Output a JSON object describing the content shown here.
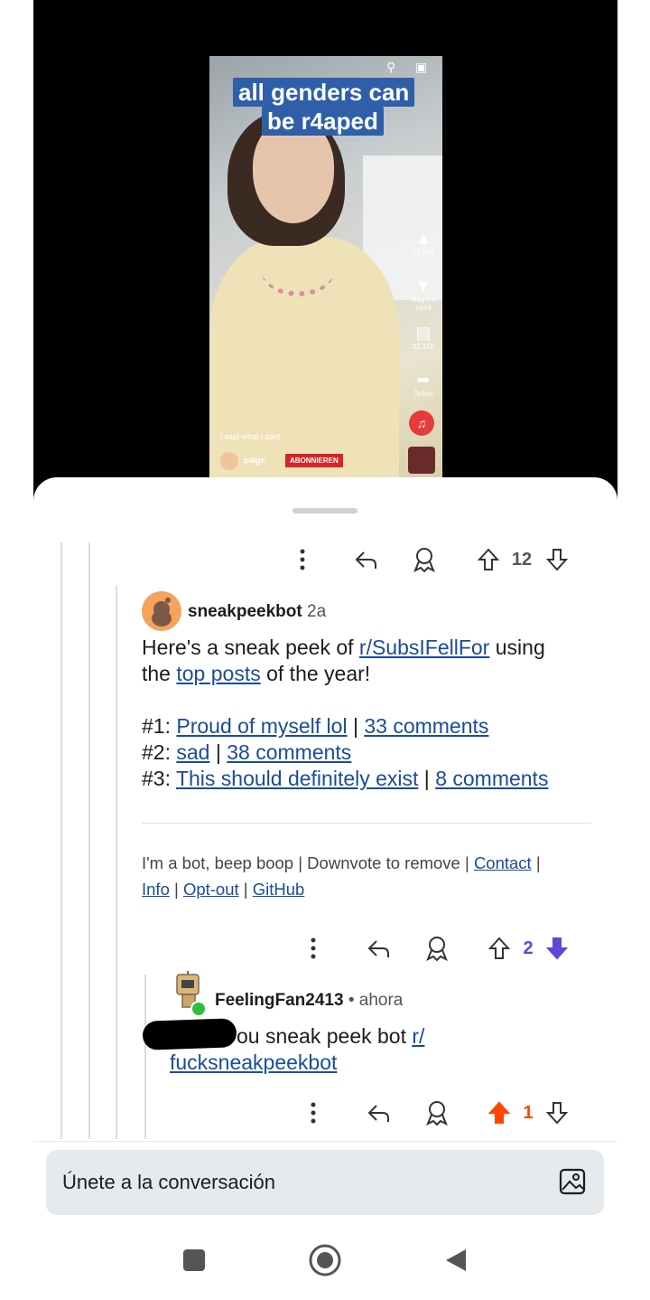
{
  "video": {
    "caption_line1": "all genders can",
    "caption_line2": "be r4aped",
    "like_count": "61,992",
    "dislike_label": "Mag ich nicht",
    "comment_count": "22.150",
    "share_label": "Teilen",
    "description": "i said what i said",
    "channel": "paige",
    "subscribe_label": "ABONNIEREN"
  },
  "post_bar": {
    "score": "12"
  },
  "comment1": {
    "author": "sneakpeekbot",
    "age": "2a",
    "line1_pre": "Here's a sneak peek of ",
    "line1_link": "r/SubsIFellFor",
    "line1_post": " using",
    "line2_pre": "the ",
    "line2_link": "top posts",
    "line2_post": " of the year!",
    "items": [
      {
        "num": "#1: ",
        "title": "Proud of myself lol",
        "sep": " | ",
        "comments": "33 comments"
      },
      {
        "num": "#2: ",
        "title": "sad",
        "sep": " | ",
        "comments": "38 comments"
      },
      {
        "num": "#3: ",
        "title": "This should definitely exist",
        "sep": " | ",
        "comments": "8 comments"
      }
    ],
    "footer_pre": "I'm a bot, beep boop | Downvote to remove | ",
    "footer_contact": "Contact",
    "footer_sep1": " |",
    "footer_info": "Info",
    "footer_sep2": " | ",
    "footer_optout": "Opt-out",
    "footer_sep3": " | ",
    "footer_github": "GitHub",
    "score": "2",
    "vote_color": "#5a4ad6"
  },
  "comment2": {
    "author": "FeelingFan2413",
    "age": "• ahora",
    "text_visible": "ou sneak peek bot ",
    "link_part1": "r/",
    "link_part2": "fucksneakpeekbot",
    "score": "1",
    "vote_color": "#ff4500"
  },
  "composer": {
    "placeholder": "Únete a la conversación"
  }
}
